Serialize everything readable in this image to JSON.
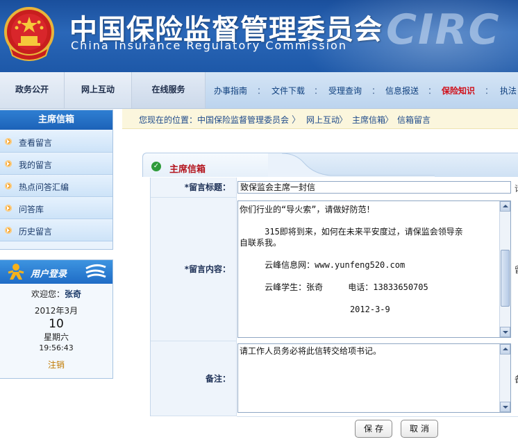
{
  "header": {
    "cn_title": "中国保险监督管理委员会",
    "en_title": "China Insurance Regulatory Commission",
    "logo_text": "CIRC"
  },
  "main_nav": {
    "tabs": [
      {
        "label": "政务公开"
      },
      {
        "label": "网上互动"
      },
      {
        "label": "在线服务"
      }
    ],
    "sub_items": [
      {
        "label": "办事指南"
      },
      {
        "label": "文件下载"
      },
      {
        "label": "受理查询"
      },
      {
        "label": "信息报送"
      },
      {
        "label": "保险知识"
      },
      {
        "label": "执法"
      }
    ],
    "separator": "："
  },
  "sidebar": {
    "mailbox_title": "主席信箱",
    "items": [
      {
        "label": "查看留言"
      },
      {
        "label": "我的留言"
      },
      {
        "label": "热点问答汇编"
      },
      {
        "label": "问答库"
      },
      {
        "label": "历史留言"
      }
    ]
  },
  "login": {
    "title": "用户登录",
    "welcome_prefix": "欢迎您：",
    "welcome_name": "张奇",
    "year_month": "2012年3月",
    "day": "10",
    "weekday": "星期六",
    "time": "19:56:43",
    "logout": "注销"
  },
  "breadcrumb": {
    "prefix": "您现在的位置：",
    "items": [
      "中国保险监督管理委员会",
      "网上互动",
      "主席信箱",
      "信箱留言"
    ],
    "arrow": "〉"
  },
  "panel": {
    "title": "主席信箱"
  },
  "form": {
    "title_label": "*留言标题：",
    "title_value": "致保监会主席一封信",
    "content_label": "*留言内容：",
    "content_lines": [
      "你们行业的“导火索”，请做好防范！",
      "",
      "     315即将到来，如何在未来平安度过，请保监会领导亲",
      "自联系我。",
      "",
      "",
      "     云峰信息网：www.yunfeng520.com",
      "",
      "     云峰学生：张奇     电话：13833650705",
      "",
      "",
      "                      2012-3-9"
    ],
    "note_label": "备注：",
    "note_value": "请工作人员务必将此信转交给项书记。",
    "right_stub_title": "请",
    "right_stub_content": "留",
    "right_stub_note": "备"
  },
  "buttons": {
    "save": "保存",
    "cancel": "取消"
  },
  "colors": {
    "banner_blue": "#1d58a8",
    "red_highlight": "#d0101a",
    "panel_title_red": "#b3131c",
    "bullet_orange": "#f29b1f"
  }
}
